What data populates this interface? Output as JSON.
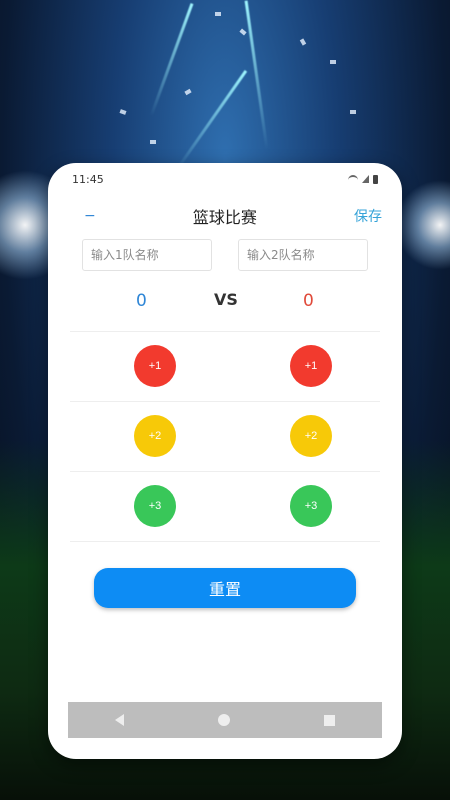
{
  "status": {
    "time": "11:45"
  },
  "header": {
    "back_icon": "back-arrow-icon",
    "title": "篮球比赛",
    "save_label": "保存"
  },
  "inputs": {
    "team1_placeholder": "输入1队名称",
    "team2_placeholder": "输入2队名称"
  },
  "score": {
    "team1": "0",
    "vs": "VS",
    "team2": "0"
  },
  "buttons": [
    {
      "label": "+1",
      "color": "#f23a2e"
    },
    {
      "label": "+2",
      "color": "#f7c908"
    },
    {
      "label": "+3",
      "color": "#39c759"
    }
  ],
  "reset_label": "重置",
  "colors": {
    "primary": "#0d8cf4",
    "team1_score": "#2f86d6",
    "team2_score": "#e04a3a"
  }
}
